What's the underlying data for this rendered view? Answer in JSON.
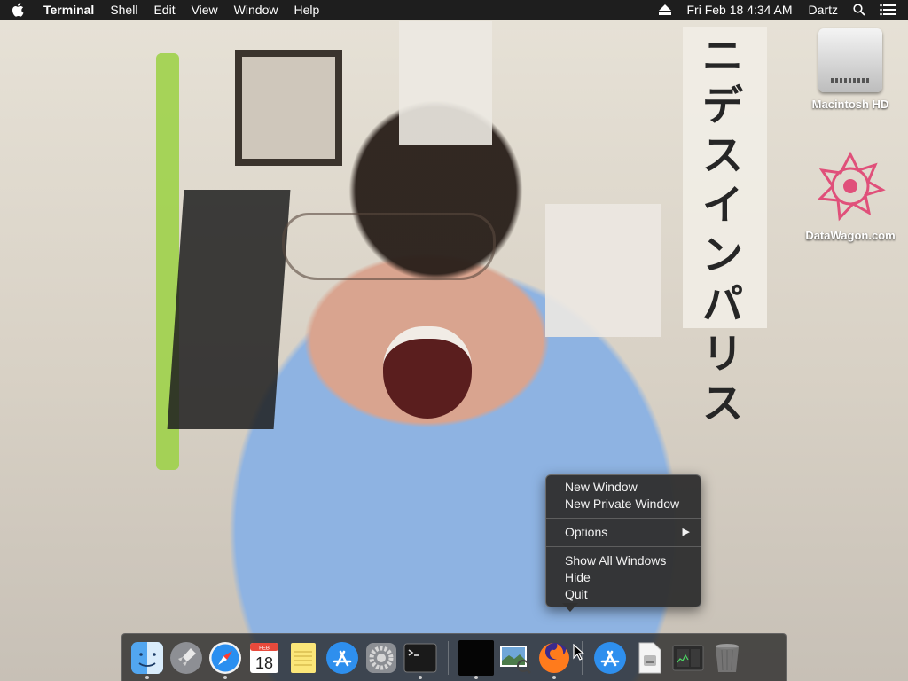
{
  "menubar": {
    "app_name": "Terminal",
    "menus": [
      "Shell",
      "Edit",
      "View",
      "Window",
      "Help"
    ],
    "datetime": "Fri Feb 18  4:34 AM",
    "user": "Dartz"
  },
  "desktop": {
    "icons": [
      {
        "label": "Macintosh HD",
        "icon": "hard-drive-icon"
      },
      {
        "label": "DataWagon.com",
        "icon": "datawagon-icon"
      }
    ],
    "wallpaper_text": "ニデスインパリス"
  },
  "context_menu": {
    "items": [
      {
        "label": "New Window"
      },
      {
        "label": "New Private Window"
      },
      {
        "label": "Options",
        "submenu": true
      },
      {
        "label": "Show All Windows"
      },
      {
        "label": "Hide"
      },
      {
        "label": "Quit"
      }
    ],
    "submenu_arrow": "▶"
  },
  "dock": {
    "calendar": {
      "month": "FEB",
      "day": "18"
    },
    "apps": [
      {
        "name": "finder-icon",
        "running": true
      },
      {
        "name": "launchpad-icon",
        "running": false
      },
      {
        "name": "safari-icon",
        "running": true
      },
      {
        "name": "calendar-icon",
        "running": false
      },
      {
        "name": "notes-icon",
        "running": false
      },
      {
        "name": "app-store-icon",
        "running": false
      },
      {
        "name": "system-preferences-icon",
        "running": false
      },
      {
        "name": "terminal-icon",
        "running": true
      },
      {
        "name": "blank-app-icon",
        "running": true
      },
      {
        "name": "preview-icon",
        "running": false
      },
      {
        "name": "firefox-icon",
        "running": true
      },
      {
        "name": "app-store-download-icon",
        "running": false
      },
      {
        "name": "file-stack-icon",
        "running": false
      },
      {
        "name": "activity-monitor-icon",
        "running": false
      },
      {
        "name": "trash-icon",
        "running": false
      }
    ]
  },
  "colors": {
    "menubar_bg": "#1e1e1e",
    "menu_bg": "#303030",
    "dock_bg": "#262626"
  }
}
